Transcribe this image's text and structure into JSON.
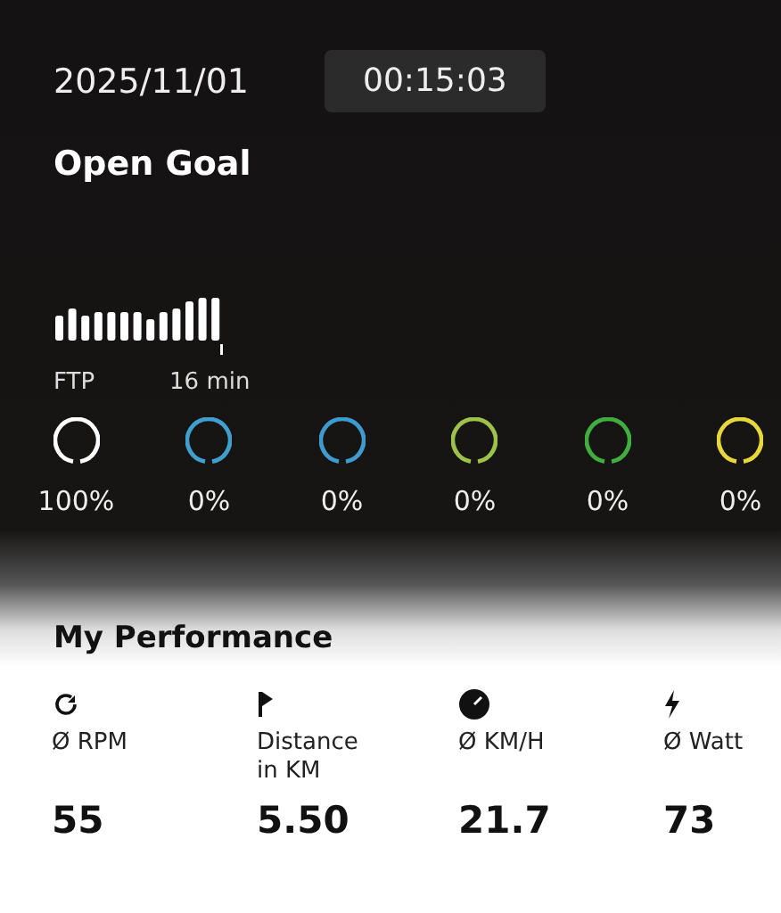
{
  "header": {
    "date": "2025/11/01",
    "timer": "00:15:03",
    "title": "Open Goal"
  },
  "workout": {
    "start_label": "FTP",
    "time_marker": "16 min"
  },
  "zones": [
    {
      "color": "#ffffff",
      "percent": "100%"
    },
    {
      "color": "#3fa0d0",
      "percent": "0%"
    },
    {
      "color": "#3f9ad0",
      "percent": "0%"
    },
    {
      "color": "#9cc24a",
      "percent": "0%"
    },
    {
      "color": "#3fae3f",
      "percent": "0%"
    },
    {
      "color": "#e6d83a",
      "percent": "0%"
    }
  ],
  "performance": {
    "title": "My Performance",
    "metrics": [
      {
        "kind": "rpm",
        "label": "Ø RPM",
        "value": "55"
      },
      {
        "kind": "distance",
        "label": "Distance in KM",
        "value": "5.50"
      },
      {
        "kind": "speed",
        "label": "Ø KM/H",
        "value": "21.7"
      },
      {
        "kind": "watt",
        "label": "Ø Watt",
        "value": "73"
      }
    ]
  }
}
